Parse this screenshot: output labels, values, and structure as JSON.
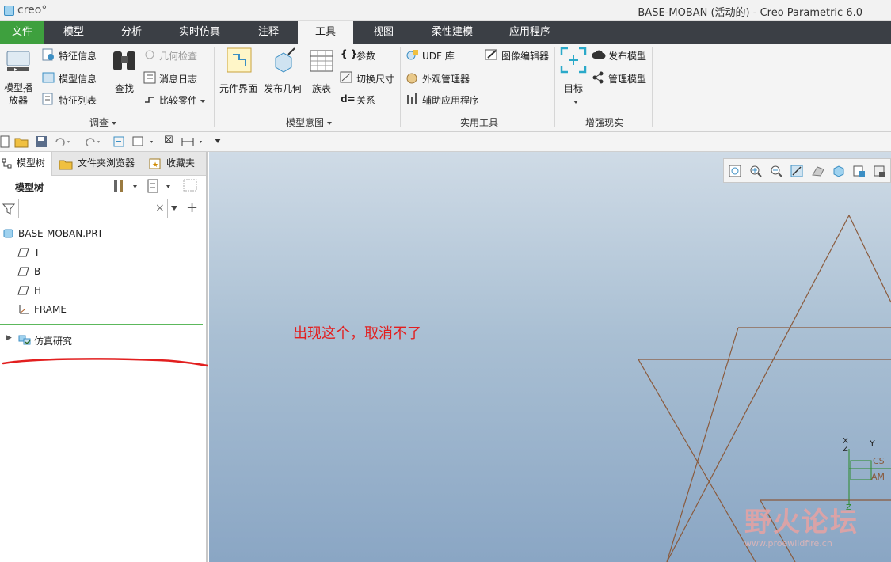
{
  "app": {
    "logo_text": "creo°",
    "window_title": "BASE-MOBAN (活动的) - Creo Parametric 6.0"
  },
  "tabs": [
    "文件",
    "模型",
    "分析",
    "实时仿真",
    "注释",
    "工具",
    "视图",
    "柔性建模",
    "应用程序"
  ],
  "active_tab": "工具",
  "ribbon": {
    "investigate": {
      "label": "调查",
      "model_player": "模型播放器",
      "feature_info": "特征信息",
      "model_info": "模型信息",
      "feature_list": "特征列表",
      "find": "查找",
      "geometry_check": "几何检查",
      "message_log": "消息日志",
      "compare_part": "比较零件"
    },
    "model_intent": {
      "label": "模型意图",
      "component_interface": "元件界面",
      "publish_geometry": "发布几何",
      "family_table": "族表",
      "parameters": "参数",
      "switch_dimensions": "切换尺寸",
      "relations": "关系"
    },
    "utilities": {
      "label": "实用工具",
      "udf_library": "UDF 库",
      "image_editor": "图像编辑器",
      "appearance_manager": "外观管理器",
      "aux_applications": "辅助应用程序"
    },
    "augmented_reality": {
      "label": "增强现实",
      "target": "目标",
      "publish_model": "发布模型",
      "manage_model": "管理模型"
    }
  },
  "panel": {
    "tabs": [
      "模型树",
      "文件夹浏览器",
      "收藏夹"
    ],
    "tree_header": "模型树",
    "search_value": "",
    "items": [
      {
        "label": "BASE-MOBAN.PRT",
        "icon": "part-icon"
      },
      {
        "label": "T",
        "icon": "datum-plane-icon"
      },
      {
        "label": "B",
        "icon": "datum-plane-icon"
      },
      {
        "label": "H",
        "icon": "datum-plane-icon"
      },
      {
        "label": "FRAME",
        "icon": "csys-icon"
      }
    ],
    "study_item": "仿真研究"
  },
  "viewport": {
    "annotation": "出现这个，取消不了",
    "watermark": "野火论坛",
    "watermark_url": "www.proewildfire.cn",
    "axis_labels": [
      "X",
      "Y",
      "Z",
      "CS",
      "AM",
      "Z"
    ]
  },
  "colors": {
    "file_tab": "#3ea03e",
    "tab_bar": "#3b3f45",
    "annotation": "#e21f1f",
    "geometry": "#8a5a3c",
    "separator_green": "#5cb85c"
  }
}
